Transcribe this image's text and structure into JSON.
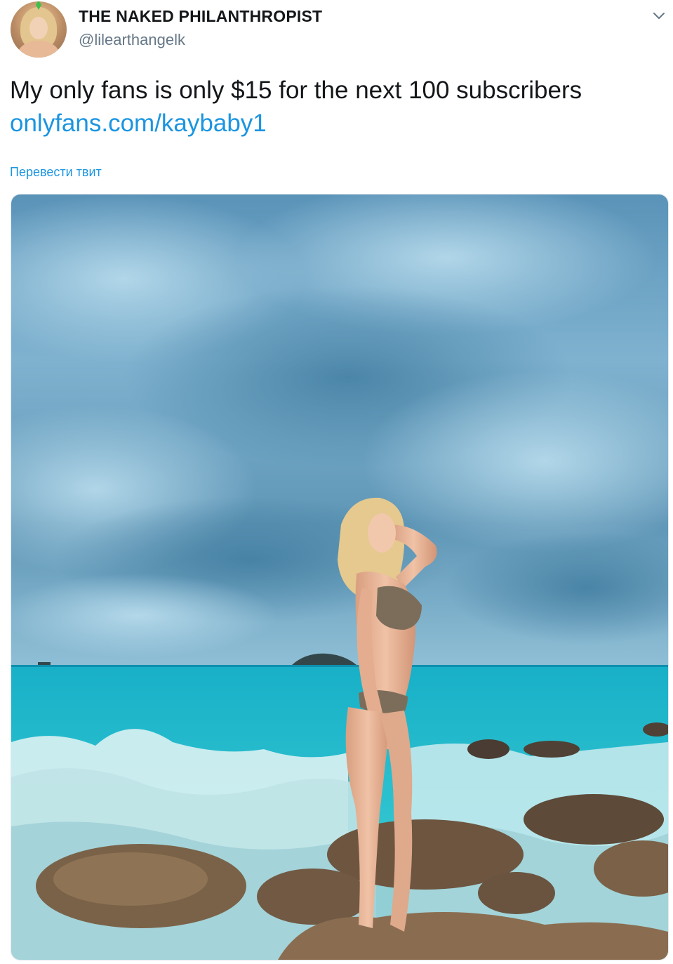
{
  "tweet": {
    "display_name": "THE NAKED PHILANTHROPIST",
    "handle": "@lilearthangelk",
    "text": "My only fans is only $15 for the next 100 subscribers",
    "link": "onlyfans.com/kaybaby1",
    "translate_label": "Перевести твит"
  },
  "icons": {
    "avatar": "avatar",
    "menu": "chevron-down-icon"
  },
  "colors": {
    "link": "#1b95e0",
    "secondary_text": "#657786",
    "primary_text": "#14171a"
  }
}
